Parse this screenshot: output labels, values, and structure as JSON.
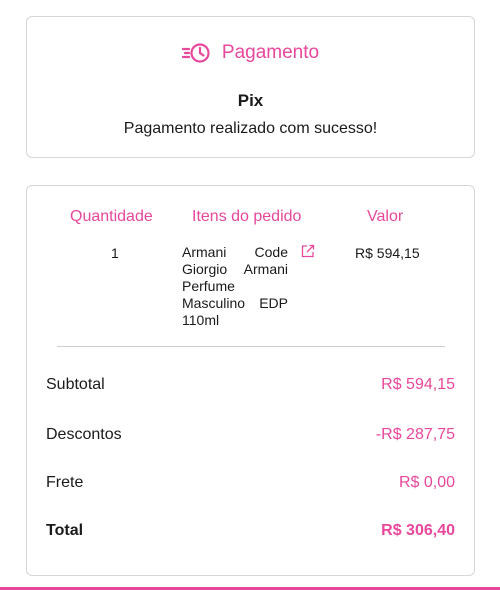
{
  "payment": {
    "icon": "fast-clock-icon",
    "title": "Pagamento",
    "method": "Pix",
    "status": "Pagamento realizado com sucesso!"
  },
  "order": {
    "columns": {
      "quantity": "Quantidade",
      "items": "Itens do pedido",
      "value": "Valor"
    },
    "items": [
      {
        "quantity": "1",
        "name": "Armani Code Giorgio Armani Perfume Masculino EDP 110ml",
        "value": "R$ 594,15",
        "link_icon": "external-link-icon"
      }
    ],
    "summary": {
      "subtotal_label": "Subtotal",
      "subtotal_value": "R$ 594,15",
      "discount_label": "Descontos",
      "discount_value": "-R$ 287,75",
      "shipping_label": "Frete",
      "shipping_value": "R$ 0,00",
      "total_label": "Total",
      "total_value": "R$ 306,40"
    }
  },
  "colors": {
    "accent": "#e8479b",
    "border": "#d6d6d6",
    "text": "#1a1a1a"
  }
}
